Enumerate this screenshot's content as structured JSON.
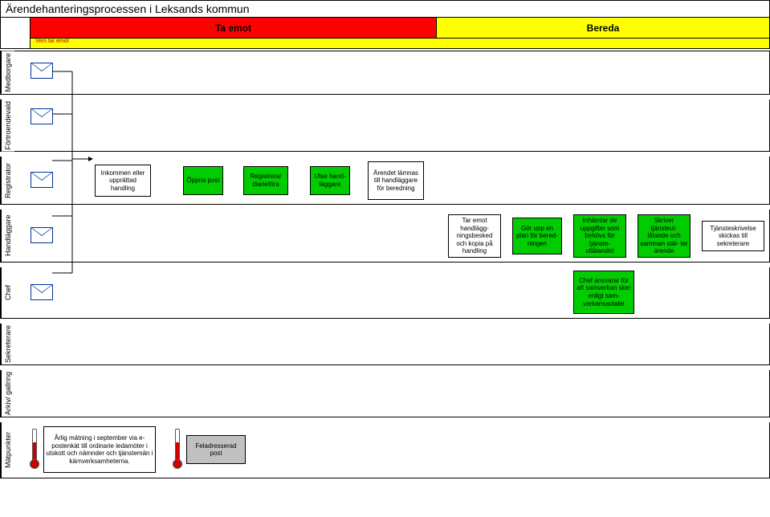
{
  "title": "Ärendehanteringsprocessen i Leksands kommun",
  "phases": {
    "ta_emot": "Ta emot",
    "bereda": "Bereda",
    "vem": "Vem tar emot"
  },
  "lanes": {
    "medborgare": "Medborgare",
    "fortroendevald": "Förtroendevald",
    "registrator": "Registrator",
    "handlaggare": "Handläggare",
    "chef": "Chef",
    "sekreterare": "Sekreterare",
    "arkiv": "Arkiv/ gallring",
    "matpunkter": "Mätpunkter"
  },
  "boxes": {
    "inkommen": "Inkommen eller upprättad handling",
    "oppna_post": "Öppna post",
    "registrera": "Registrera/ diarieföra",
    "utse": "Utse hand- läggare",
    "arendet_lamnas": "Ärendet lämnas till handläggare för beredning",
    "tar_emot": "Tar emot handlägg- ningsbesked och kopia på handling",
    "gor_upp": "Gör upp en plan för bered- ningen",
    "inhamtar": "Inhämtar de uppgifter som behövs för tjänste- utlåtandet",
    "skriver": "Skriver tjänsteut- låtande och samman stäl- ler ärende",
    "tjansteskr": "Tjänsteskrivelse skickas till sekreterare",
    "chef_ansvarar": "Chef ansvarar för att samverkan sker enligt sam- verkansavtalet",
    "arlig": "Årlig mätning i september via e-postenkät till ordinarie ledamöter i utskott och nämnder och tjänstemän i kärnverksamheterna.",
    "feladresserad": "Feladresserad post"
  }
}
